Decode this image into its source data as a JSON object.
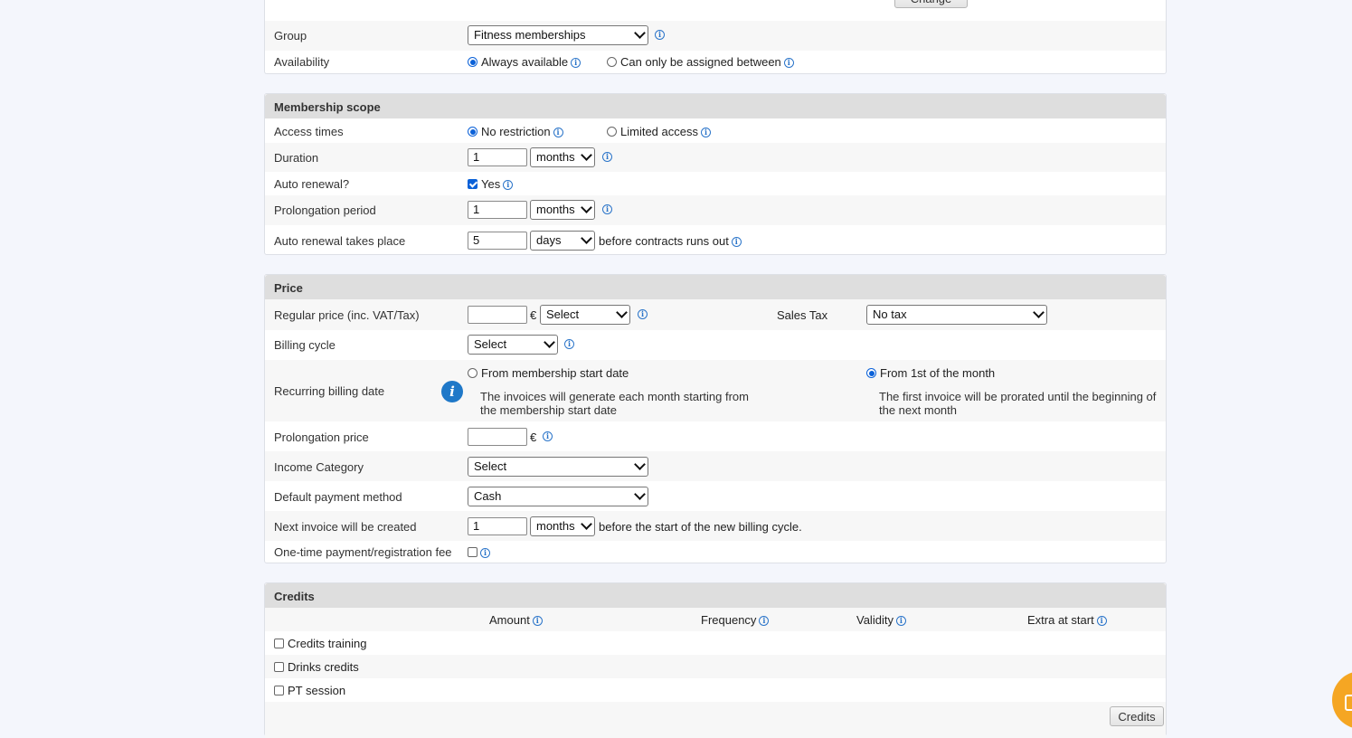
{
  "top": {
    "change_button": "Change",
    "group_label": "Group",
    "group_value": "Fitness memberships",
    "availability_label": "Availability",
    "availability_opt1": "Always available",
    "availability_opt2": "Can only be assigned between",
    "availability_selected": "Always available"
  },
  "scope": {
    "title": "Membership scope",
    "access_label": "Access times",
    "access_opt1": "No restriction",
    "access_opt2": "Limited access",
    "duration_label": "Duration",
    "duration_value": "1",
    "duration_unit": "months",
    "auto_renewal_label": "Auto renewal?",
    "auto_renewal_yes": "Yes",
    "prolongation_label": "Prolongation period",
    "prolongation_value": "1",
    "prolongation_unit": "months",
    "renewal_takes_label": "Auto renewal takes place",
    "renewal_takes_value": "5",
    "renewal_takes_unit": "days",
    "renewal_takes_suffix": "before contracts runs out"
  },
  "price": {
    "title": "Price",
    "regular_label": "Regular price (inc. VAT/Tax)",
    "regular_value": "",
    "currency": "€",
    "regular_select": "Select",
    "sales_tax_label": "Sales Tax",
    "sales_tax_value": "No tax",
    "billing_cycle_label": "Billing cycle",
    "billing_cycle_value": "Select",
    "recurring_label": "Recurring billing date",
    "recurring_opt1": "From membership start date",
    "recurring_opt1_note": "The invoices will generate each month starting from the membership start date",
    "recurring_opt2": "From 1st of the month",
    "recurring_opt2_note": "The first invoice will be prorated until the beginning of the next month",
    "prolongation_price_label": "Prolongation price",
    "prolongation_price_value": "",
    "income_label": "Income Category",
    "income_value": "Select",
    "payment_label": "Default payment method",
    "payment_value": "Cash",
    "next_invoice_label": "Next invoice will be created",
    "next_invoice_value": "1",
    "next_invoice_unit": "months",
    "next_invoice_suffix": "before the start of the new billing cycle.",
    "onetime_label": "One-time payment/registration fee"
  },
  "credits": {
    "title": "Credits",
    "col_amount": "Amount",
    "col_frequency": "Frequency",
    "col_validity": "Validity",
    "col_extra": "Extra at start",
    "items": [
      "Credits training",
      "Drinks credits",
      "PT session"
    ],
    "button": "Credits"
  },
  "colors": {
    "accent": "#0b61d8",
    "info": "#2a74c9",
    "chat_widget": "#f5a623"
  }
}
